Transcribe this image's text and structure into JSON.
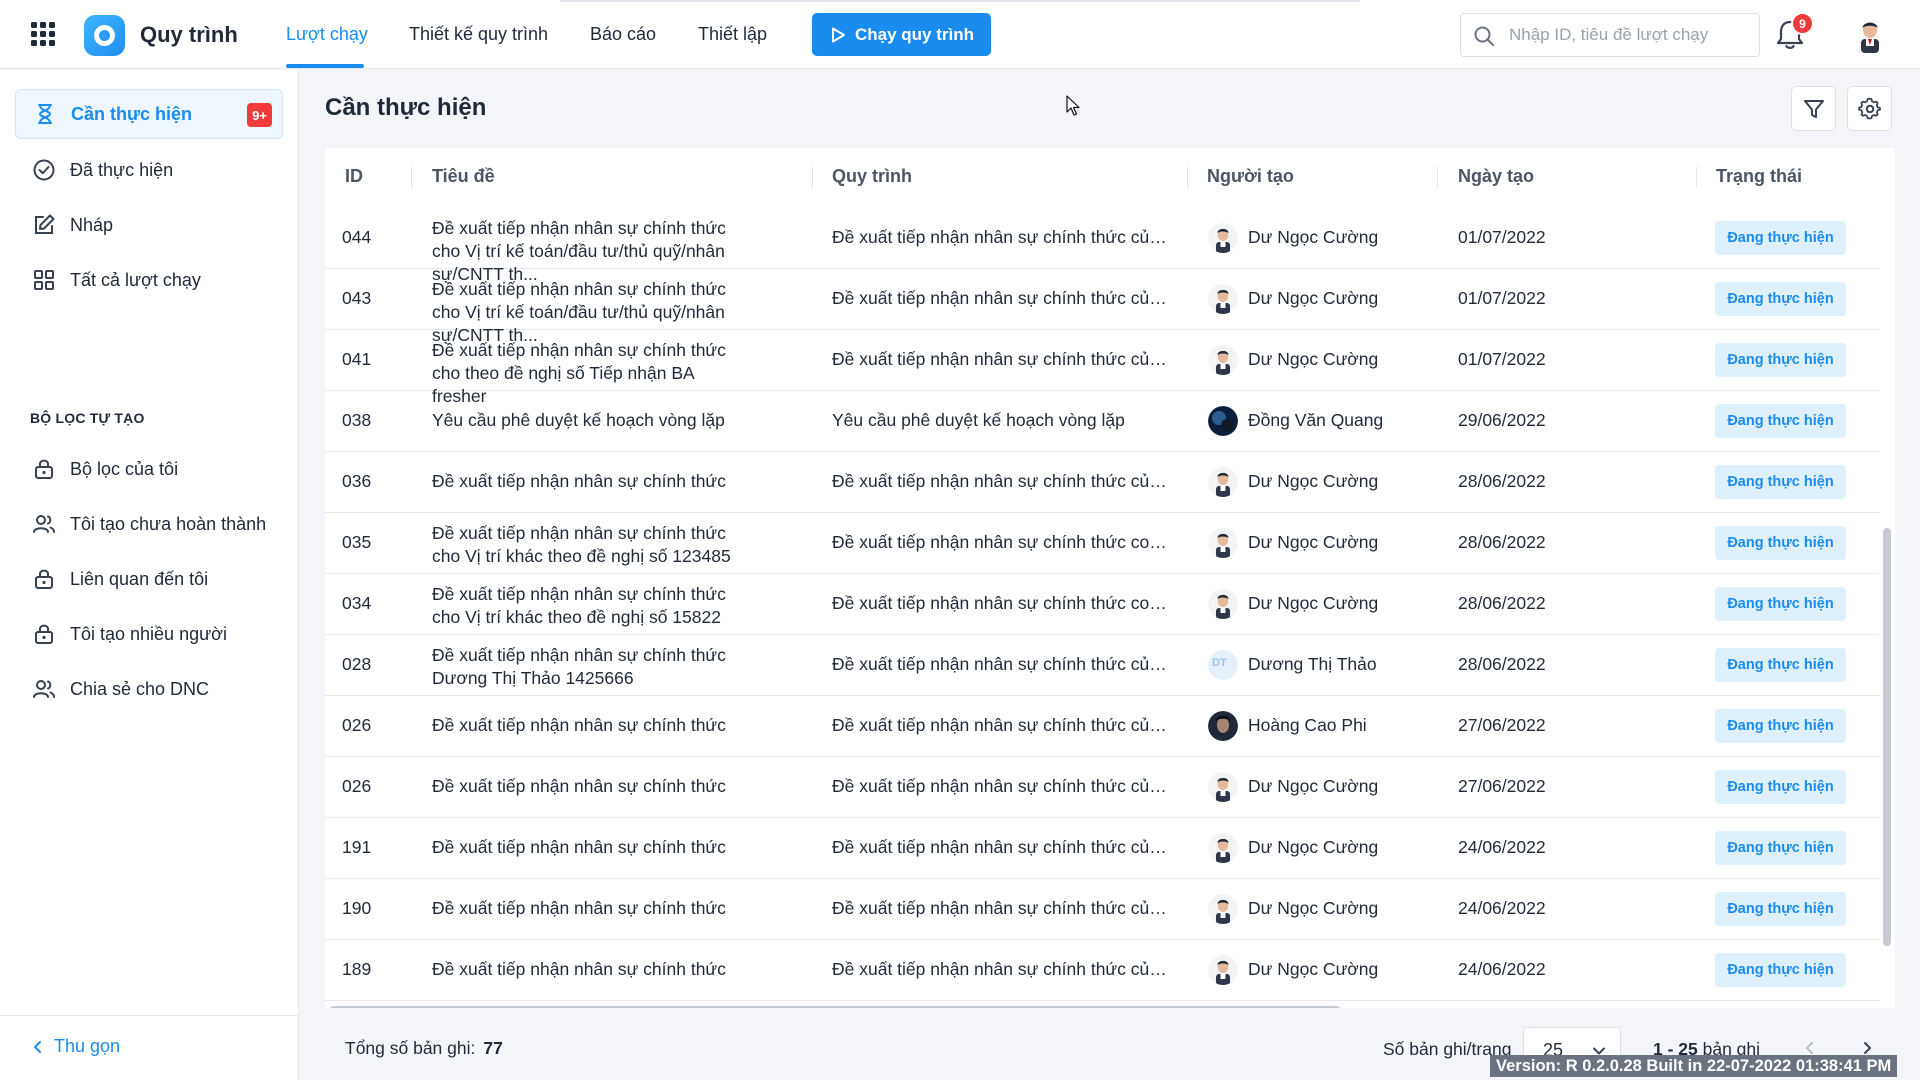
{
  "app": {
    "title": "Quy trình"
  },
  "nav": {
    "tabs": [
      {
        "label": "Lượt chạy",
        "active": true
      },
      {
        "label": "Thiết kế quy trình"
      },
      {
        "label": "Báo cáo"
      },
      {
        "label": "Thiết lập"
      }
    ],
    "run_button": "Chạy quy trình"
  },
  "search": {
    "placeholder": "Nhập ID, tiêu đề lượt chạy"
  },
  "notifications": {
    "count": "9"
  },
  "sidebar": {
    "items": [
      {
        "label": "Cần thực hiện",
        "icon": "hourglass-icon",
        "badge": "9+",
        "active": true
      },
      {
        "label": "Đã thực hiện",
        "icon": "check-circle-icon"
      },
      {
        "label": "Nháp",
        "icon": "edit-icon"
      },
      {
        "label": "Tất cả lượt chạy",
        "icon": "grid-icon"
      }
    ],
    "section_title": "BỘ LỌC TỰ TẠO",
    "filters": [
      {
        "label": "Bộ lọc của tôi",
        "icon": "lock-icon"
      },
      {
        "label": "Tôi tạo chưa hoàn thành",
        "icon": "users-icon"
      },
      {
        "label": "Liên quan đến tôi",
        "icon": "lock-icon"
      },
      {
        "label": "Tôi tạo nhiều người",
        "icon": "lock-icon"
      },
      {
        "label": "Chia sẻ cho DNC",
        "icon": "users-icon"
      }
    ],
    "collapse_label": "Thu gọn"
  },
  "page": {
    "title": "Cần thực hiện"
  },
  "table": {
    "columns": [
      "ID",
      "Tiêu đề",
      "Quy trình",
      "Người tạo",
      "Ngày tạo",
      "Trạng thái"
    ],
    "rows": [
      {
        "id": "044",
        "title": "Đề xuất tiếp nhận nhân sự chính thức cho Vị trí kế toán/đầu tư/thủ quỹ/nhân sự/CNTT th...",
        "process": "Đề xuất tiếp nhận nhân sự chính thức của...",
        "creator": "Dư Ngọc Cường",
        "avatar": "person",
        "date": "01/07/2022",
        "status": "Đang thực hiện"
      },
      {
        "id": "043",
        "title": "Đề xuất tiếp nhận nhân sự chính thức cho Vị trí kế toán/đầu tư/thủ quỹ/nhân sự/CNTT th...",
        "process": "Đề xuất tiếp nhận nhân sự chính thức của...",
        "creator": "Dư Ngọc Cường",
        "avatar": "person",
        "date": "01/07/2022",
        "status": "Đang thực hiện"
      },
      {
        "id": "041",
        "title": "Đề xuất tiếp nhận nhân sự chính thức cho theo đề nghị số Tiếp nhận BA fresher",
        "process": "Đề xuất tiếp nhận nhân sự chính thức của...",
        "creator": "Dư Ngọc Cường",
        "avatar": "person",
        "date": "01/07/2022",
        "status": "Đang thực hiện"
      },
      {
        "id": "038",
        "title": "Yêu cầu phê duyệt kế hoạch vòng lặp",
        "process": "Yêu cầu phê duyệt kế hoạch vòng lặp",
        "creator": "Đồng Văn Quang",
        "avatar": "dark",
        "date": "29/06/2022",
        "status": "Đang thực hiện"
      },
      {
        "id": "036",
        "title": "Đề xuất tiếp nhận nhân sự chính thức",
        "process": "Đề xuất tiếp nhận nhân sự chính thức của...",
        "creator": "Dư Ngọc Cường",
        "avatar": "person",
        "date": "28/06/2022",
        "status": "Đang thực hiện"
      },
      {
        "id": "035",
        "title": "Đề xuất tiếp nhận nhân sự chính thức cho Vị trí khác theo đề nghị số 123485",
        "process": "Đề xuất tiếp nhận nhân sự chính thức cop...",
        "creator": "Dư Ngọc Cường",
        "avatar": "person",
        "date": "28/06/2022",
        "status": "Đang thực hiện"
      },
      {
        "id": "034",
        "title": "Đề xuất tiếp nhận nhân sự chính thức cho Vị trí khác theo đề nghị số 15822",
        "process": "Đề xuất tiếp nhận nhân sự chính thức cop...",
        "creator": "Dư Ngọc Cường",
        "avatar": "person",
        "date": "28/06/2022",
        "status": "Đang thực hiện"
      },
      {
        "id": "028",
        "title": "Đề xuất tiếp nhận nhân sự chính thức Dương Thị Thảo 1425666",
        "process": "Đề xuất tiếp nhận nhân sự chính thức của...",
        "creator": "Dương Thị Thảo",
        "avatar": "initials",
        "initials": "DT",
        "date": "28/06/2022",
        "status": "Đang thực hiện"
      },
      {
        "id": "026",
        "title": "Đề xuất tiếp nhận nhân sự chính thức",
        "process": "Đề xuất tiếp nhận nhân sự chính thức của...",
        "creator": "Hoàng Cao Phi",
        "avatar": "dark2",
        "date": "27/06/2022",
        "status": "Đang thực hiện"
      },
      {
        "id": "026",
        "title": "Đề xuất tiếp nhận nhân sự chính thức",
        "process": "Đề xuất tiếp nhận nhân sự chính thức của...",
        "creator": "Dư Ngọc Cường",
        "avatar": "person",
        "date": "27/06/2022",
        "status": "Đang thực hiện"
      },
      {
        "id": "191",
        "title": "Đề xuất tiếp nhận nhân sự chính thức",
        "process": "Đề xuất tiếp nhận nhân sự chính thức của...",
        "creator": "Dư Ngọc Cường",
        "avatar": "person",
        "date": "24/06/2022",
        "status": "Đang thực hiện"
      },
      {
        "id": "190",
        "title": "Đề xuất tiếp nhận nhân sự chính thức",
        "process": "Đề xuất tiếp nhận nhân sự chính thức của...",
        "creator": "Dư Ngọc Cường",
        "avatar": "person",
        "date": "24/06/2022",
        "status": "Đang thực hiện"
      },
      {
        "id": "189",
        "title": "Đề xuất tiếp nhận nhân sự chính thức",
        "process": "Đề xuất tiếp nhận nhân sự chính thức của...",
        "creator": "Dư Ngọc Cường",
        "avatar": "person",
        "date": "24/06/2022",
        "status": "Đang thực hiện"
      }
    ]
  },
  "footer": {
    "total_label": "Tổng số bản ghi:",
    "total_value": "77",
    "per_page_label": "Số bản ghi/trang",
    "per_page_value": "25",
    "range": "1 - 25",
    "range_suffix": "bản ghi",
    "version": "Version: R 0.2.0.28 Built in 22-07-2022 01:38:41 PM"
  },
  "colors": {
    "accent": "#1a8cf0",
    "badge": "#ef3b3b",
    "status_bg": "#dff0fd"
  }
}
